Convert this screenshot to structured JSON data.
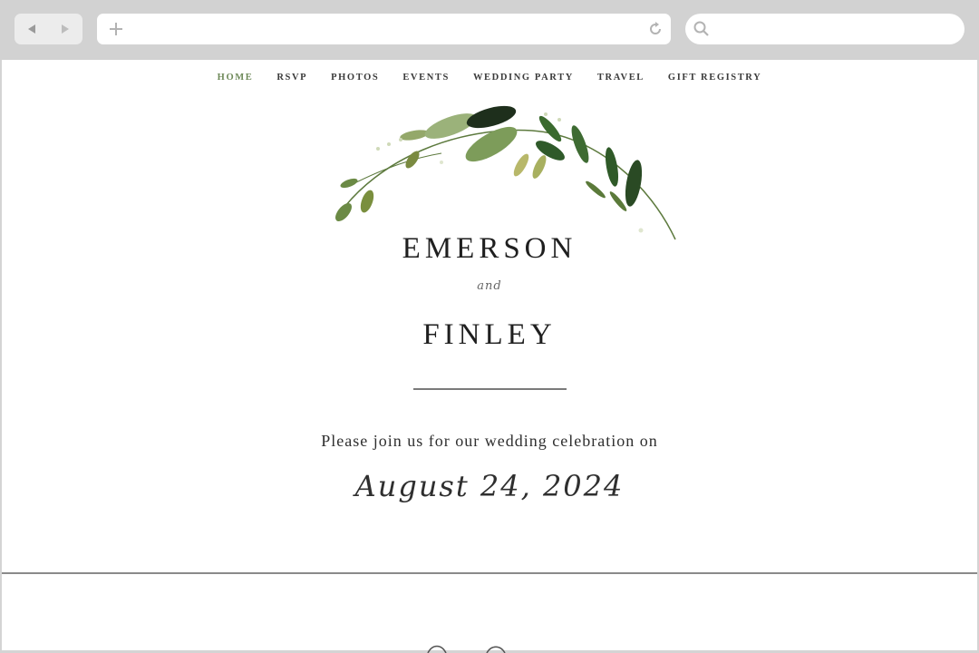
{
  "browser": {
    "address_value": "",
    "search_placeholder": ""
  },
  "nav": {
    "items": [
      {
        "label": "HOME",
        "active": true
      },
      {
        "label": "RSVP",
        "active": false
      },
      {
        "label": "PHOTOS",
        "active": false
      },
      {
        "label": "EVENTS",
        "active": false
      },
      {
        "label": "WEDDING PARTY",
        "active": false
      },
      {
        "label": "TRAVEL",
        "active": false
      },
      {
        "label": "GIFT REGISTRY",
        "active": false
      }
    ]
  },
  "hero": {
    "name_one": "EMERSON",
    "conjunction": "and",
    "name_two": "FINLEY",
    "invite_text": "Please join us for our wedding celebration on",
    "date": "August 24, 2024"
  },
  "icons": [
    "back-arrow-icon",
    "forward-arrow-icon",
    "plus-icon",
    "reload-icon",
    "search-icon",
    "leaf-wreath-icon"
  ],
  "colors": {
    "chrome": "#d2d2d2",
    "nav_active": "#6f8a5a",
    "text": "#1f1f1f",
    "leaf_dark": "#2f4a2a",
    "leaf_mid": "#6b8a45",
    "leaf_light": "#a8b86a"
  }
}
